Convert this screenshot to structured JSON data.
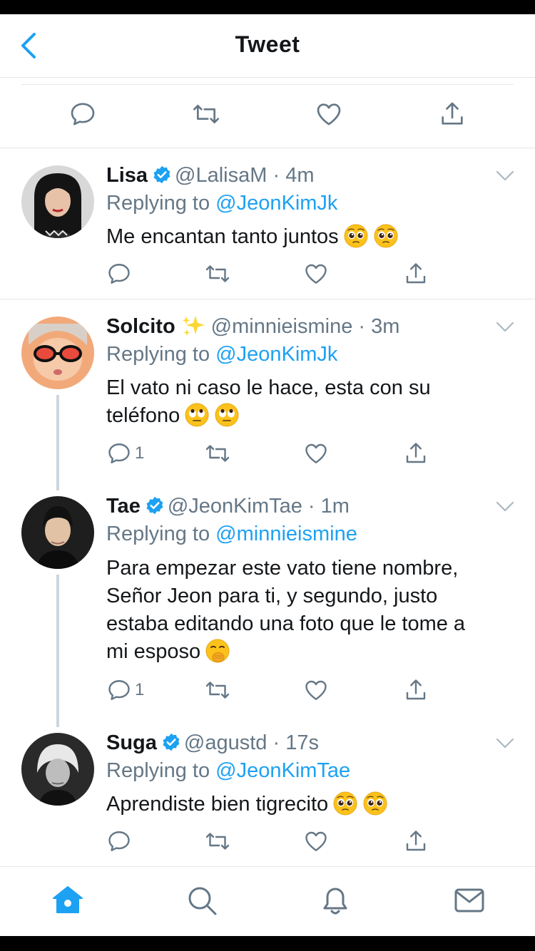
{
  "header": {
    "title": "Tweet"
  },
  "colors": {
    "accent": "#1da1f2",
    "muted": "#657786",
    "divider": "#e1e8ed"
  },
  "main_actions": [
    "reply-icon",
    "retweet-icon",
    "like-icon",
    "share-icon"
  ],
  "replies": [
    {
      "name": "Lisa",
      "verified": true,
      "handle": "@LalisaM",
      "time": "4m",
      "replying_label": "Replying to",
      "replying_to": "@JeonKimJk",
      "text": "Me encantan tanto juntos",
      "emoji": [
        "pleading-face",
        "pleading-face"
      ],
      "reply_count": ""
    },
    {
      "name": "Solcito",
      "sparkles": "✨",
      "handle": "@minnieismine",
      "time": "3m",
      "replying_label": "Replying to",
      "replying_to": "@JeonKimJk",
      "text_line1": "El vato ni caso le hace, esta con su",
      "text_line2": "teléfono",
      "emoji": [
        "rolling-eyes",
        "rolling-eyes"
      ],
      "reply_count": "1"
    },
    {
      "name": "Tae",
      "verified": true,
      "handle": "@JeonKimTae",
      "time": "1m",
      "replying_label": "Replying to",
      "replying_to": "@minnieismine",
      "text_line1": "Para empezar este vato tiene nombre,",
      "text_line2": "Señor Jeon para ti, y segundo, justo",
      "text_line3": "estaba editando una foto que le tome a",
      "text_line4": "mi esposo",
      "emoji": [
        "face-with-hand-over-mouth"
      ],
      "reply_count": "1"
    },
    {
      "name": "Suga",
      "verified": true,
      "handle": "@agustd",
      "time": "17s",
      "replying_label": "Replying to",
      "replying_to": "@JeonKimTae",
      "text": "Aprendiste bien tigrecito",
      "emoji": [
        "pleading-face",
        "pleading-face"
      ],
      "reply_count": ""
    }
  ],
  "tabs": [
    "home-icon",
    "search-icon",
    "notifications-icon",
    "messages-icon"
  ]
}
